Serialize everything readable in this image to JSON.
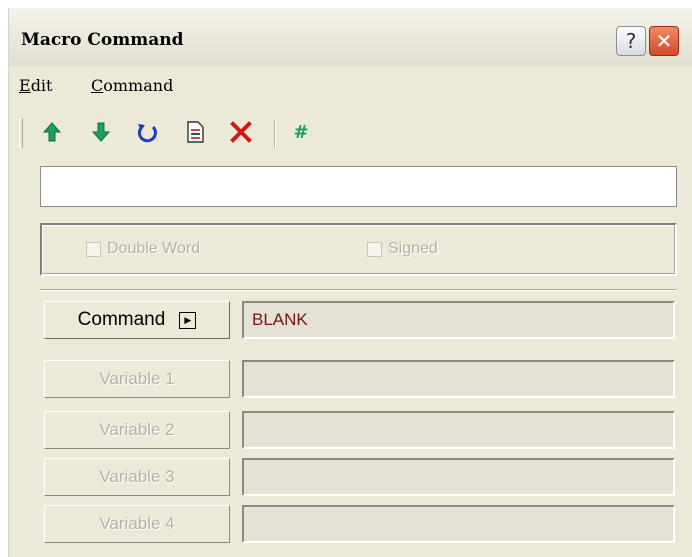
{
  "window": {
    "title": "Macro Command"
  },
  "titlebar_buttons": {
    "help": "?",
    "close": "✕"
  },
  "menu": [
    {
      "label": "Edit",
      "mnemonic": "E"
    },
    {
      "label": "Command",
      "mnemonic": "C"
    }
  ],
  "toolbar": {
    "icons": [
      "move-up-icon",
      "move-down-icon",
      "undo-icon",
      "document-icon",
      "delete-icon",
      "hash-icon"
    ],
    "colors": {
      "arrows": "#1a9e5a",
      "undo": "#1c3ec8",
      "delete": "#d01818",
      "hash": "#1a9e5a"
    }
  },
  "command_text": "",
  "options": {
    "double_word": "Double Word",
    "signed": "Signed"
  },
  "rows": [
    {
      "label": "Command",
      "value": "BLANK",
      "enabled": true
    },
    {
      "label": "Variable 1",
      "value": "",
      "enabled": false
    },
    {
      "label": "Variable 2",
      "value": "",
      "enabled": false
    },
    {
      "label": "Variable 3",
      "value": "",
      "enabled": false
    },
    {
      "label": "Variable 4",
      "value": "",
      "enabled": false
    }
  ]
}
